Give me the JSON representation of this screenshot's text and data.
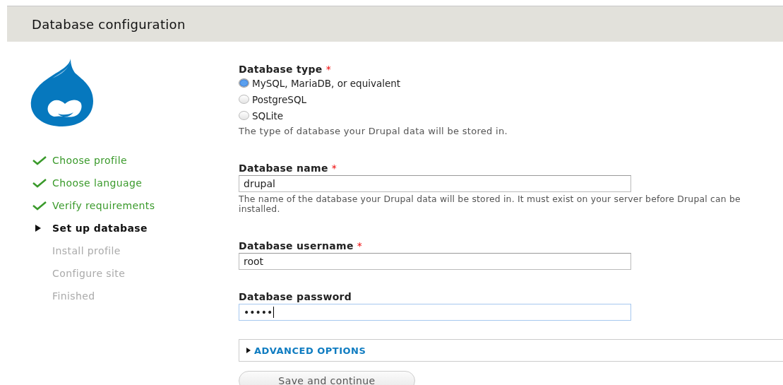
{
  "header": {
    "title": "Database configuration"
  },
  "steps": [
    {
      "label": "Choose profile",
      "kind": "done"
    },
    {
      "label": "Choose language",
      "kind": "done"
    },
    {
      "label": "Verify requirements",
      "kind": "done"
    },
    {
      "label": "Set up database",
      "kind": "active"
    },
    {
      "label": "Install profile",
      "kind": "pending"
    },
    {
      "label": "Configure site",
      "kind": "pending"
    },
    {
      "label": "Finished",
      "kind": "pending"
    }
  ],
  "database_type": {
    "label": "Database type",
    "required_mark": "*",
    "options": [
      {
        "label": "MySQL, MariaDB, or equivalent",
        "selected": true
      },
      {
        "label": "PostgreSQL",
        "selected": false
      },
      {
        "label": "SQLite",
        "selected": false
      }
    ],
    "description": "The type of database your Drupal data will be stored in."
  },
  "fields": [
    {
      "label": "Database name",
      "required_mark": "*",
      "value": "drupal",
      "focused": false,
      "description": "The name of the database your Drupal data will be stored in. It must exist on your server before Drupal can be installed."
    },
    {
      "label": "Database username",
      "required_mark": "*",
      "value": "root",
      "focused": false
    },
    {
      "label": "Database password",
      "value": "•••••",
      "focused": true
    }
  ],
  "advanced_options": {
    "label": "ADVANCED OPTIONS",
    "expanded": false
  },
  "buttons": [
    "Save and continue"
  ]
}
